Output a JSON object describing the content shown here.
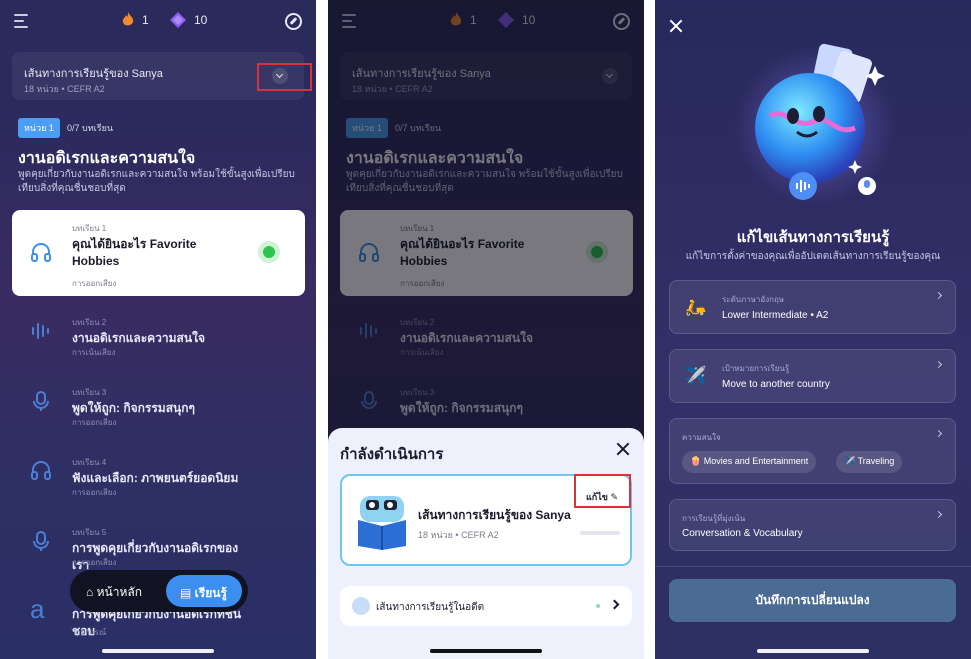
{
  "streak": {
    "fire_count": "1",
    "gem_count": "10"
  },
  "path": {
    "title": "เส้นทางการเรียนรู้ของ Sanya",
    "sub": "18 หน่วย • CEFR A2"
  },
  "unit": {
    "badge": "หน่วย 1",
    "progress": "0/7 บทเรียน",
    "title": "งานอดิเรกและความสนใจ",
    "desc": "พูดคุยเกี่ยวกับงานอดิเรกและความสนใจ พร้อมใช้ขั้นสูงเพื่อเปรียบเทียบสิ่งที่คุณชื่นชอบที่สุด"
  },
  "lessons": [
    {
      "kicker": "บทเรียน 1",
      "title": "คุณได้ยินอะไร Favorite Hobbies",
      "sub": "การออกเสียง",
      "icon": "headphones-icon"
    },
    {
      "kicker": "บทเรียน 2",
      "title": "งานอดิเรกและความสนใจ",
      "sub": "การเน้นเสียง",
      "icon": "soundwave-icon"
    },
    {
      "kicker": "บทเรียน 3",
      "title": "พูดให้ถูก: กิจกรรมสนุกๆ",
      "sub": "การออกเสียง",
      "icon": "microphone-icon"
    },
    {
      "kicker": "บทเรียน 4",
      "title": "ฟังและเลือก: ภาพยนตร์ยอดนิยม",
      "sub": "การออกเสียง",
      "icon": "headphones-icon"
    },
    {
      "kicker": "บทเรียน 5",
      "title": "การพูดคุยเกี่ยวกับงานอดิเรกของเรา",
      "sub": "การออกเสียง",
      "icon": "microphone-icon"
    },
    {
      "kicker": "",
      "title": "การพูดคุยเกี่ยวกับงานอดิเรกที่ชื่นชอบ",
      "sub": "ไวยากรณ์",
      "icon": "letter-a-icon"
    }
  ],
  "nav": {
    "home": "หน้าหลัก",
    "learn": "เรียนรู้"
  },
  "sheet": {
    "title": "กำลังดำเนินการ",
    "card_title": "เส้นทางการเรียนรู้ของ Sanya",
    "card_sub": "18 หน่วย • CEFR A2",
    "edit": "แก้ไข",
    "past": "เส้นทางการเรียนรู้ในอดีต"
  },
  "edit_screen": {
    "title": "แก้ไขเส้นทางการเรียนรู้",
    "sub": "แก้ไขการตั้งค่าของคุณเพื่ออัปเดตเส้นทางการเรียนรู้ของคุณ",
    "level": {
      "kicker": "ระดับภาษาอังกฤษ",
      "value": "Lower Intermediate",
      "cefr": "A2",
      "icon": "scooter-icon"
    },
    "goal": {
      "kicker": "เป้าหมายการเรียนรู้",
      "value": "Move to another country",
      "icon": "airplane-icon"
    },
    "interests": {
      "kicker": "ความสนใจ",
      "chips": [
        "Movies and Entertainment",
        "Traveling"
      ]
    },
    "focus": {
      "kicker": "การเรียนรู้ที่มุ่งเน้น",
      "value": "Conversation & Vocabulary"
    },
    "save": "บันทึกการเปลี่ยนแปลง"
  },
  "colors": {
    "accent": "#3c8ff0",
    "highlight_box": "#d9333a",
    "progress_green": "#2cc44a"
  }
}
